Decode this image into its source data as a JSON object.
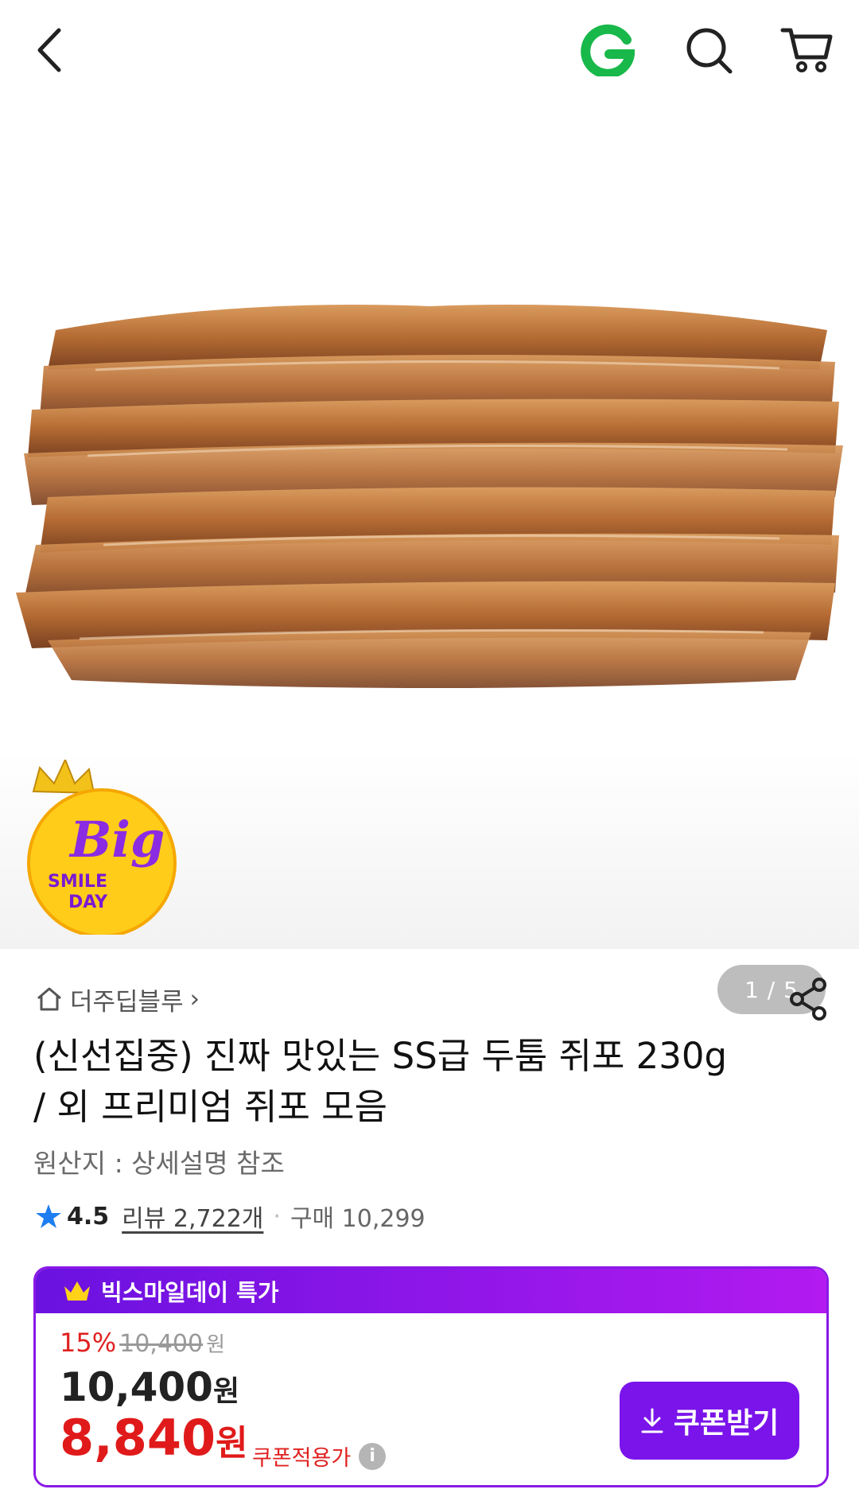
{
  "topbar": {
    "icons": [
      "back-arrow-icon",
      "g-logo-icon",
      "search-icon",
      "cart-icon"
    ],
    "g_logo_letter": "G",
    "colors": {
      "g_logo": "#18b84a"
    }
  },
  "gallery": {
    "pager": "1 / 5",
    "badge": {
      "line1": "Big",
      "line2": "SMILE",
      "line3": "DAY"
    }
  },
  "product": {
    "store_name": "더주딥블루",
    "store_chevron": "›",
    "title": "(신선집중) 진짜 맛있는 SS급 두툼 쥐포 230g / 외 프리미엄 쥐포 모음",
    "origin": "원산지 : 상세설명 참조",
    "rating": "4.5",
    "review_label": "리뷰 2,722개",
    "dot": "·",
    "purchase_label": "구매 10,299"
  },
  "deal": {
    "header": "빅스마일데이 특가",
    "discount_pct": "15%",
    "original_price": "10,400",
    "original_unit": "원",
    "base_price": "10,400",
    "base_unit": "원",
    "sale_price": "8,840",
    "sale_unit": "원",
    "coupon_applied_label": "쿠폰적용가",
    "info_glyph": "i",
    "coupon_button": "쿠폰받기",
    "colors": {
      "accent": "#7a14ea",
      "sale": "#e01a1a"
    }
  }
}
